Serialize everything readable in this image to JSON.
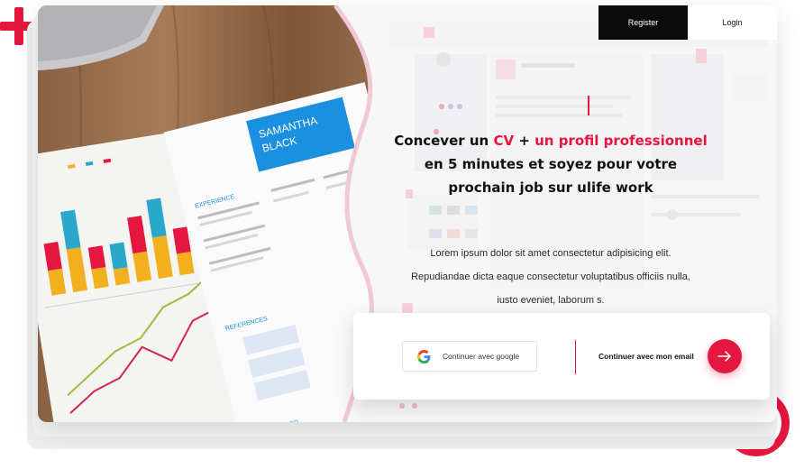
{
  "nav": {
    "register_label": "Register",
    "login_label": "Login"
  },
  "hero": {
    "headline_part1": "Concever un ",
    "headline_cv": "CV",
    "headline_part2": " + ",
    "headline_profil": "un profil professionnel",
    "headline_part3": " en 5 minutes et soyez pour votre prochain job sur ulife work",
    "description_line1": "Lorem ipsum dolor sit amet consectetur adipisicing elit.",
    "description_line2": "Repudiandae dicta eaque consectetur voluptatibus officiis nulla,",
    "description_line3": "iusto eveniet, laborum s."
  },
  "auth": {
    "google_label": "Continuer avec google",
    "email_label": "Continuer avec mon email"
  },
  "resume_photo": {
    "name": "SAMANTHA BLACK",
    "sections": [
      "EXPERIENCE",
      "REFERENCES",
      "COVER LETTER"
    ]
  },
  "colors": {
    "brand_red": "#e5173f",
    "dark": "#0b0b0b",
    "background": "#f7f7f8"
  },
  "icons": {
    "google": "google-g-icon",
    "arrow": "arrow-right-icon",
    "plus": "plus-icon",
    "ring": "ring-decoration"
  }
}
